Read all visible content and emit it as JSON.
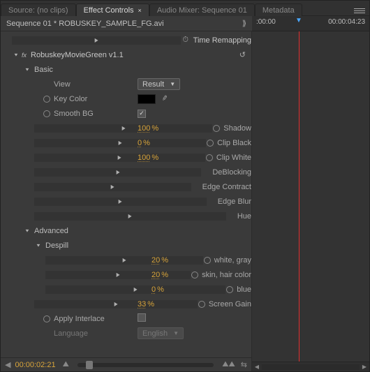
{
  "tabs": {
    "source": "Source: (no clips)",
    "effect_controls": "Effect Controls",
    "audio_mixer": "Audio Mixer: Sequence 01",
    "metadata": "Metadata"
  },
  "header": {
    "breadcrumb": "Sequence 01 * ROBUSKEY_SAMPLE_FG.avi"
  },
  "timeline": {
    "start_tc": ":00:00",
    "end_tc": "00:00:04:23"
  },
  "effects": {
    "time_remapping": "Time Remapping",
    "robuskey": {
      "title": "RobuskeyMovieGreen v1.1",
      "basic": {
        "label": "Basic",
        "view": {
          "label": "View",
          "value": "Result"
        },
        "key_color": {
          "label": "Key Color"
        },
        "smooth_bg": {
          "label": "Smooth BG",
          "checked": true
        },
        "shadow": {
          "label": "Shadow",
          "value": "100",
          "unit": "%"
        },
        "clip_black": {
          "label": "Clip Black",
          "value": "0",
          "unit": "%"
        },
        "clip_white": {
          "label": "Clip White",
          "value": "100",
          "unit": "%"
        },
        "deblocking": {
          "label": "DeBlocking"
        },
        "edge_contract": {
          "label": "Edge Contract"
        },
        "edge_blur": {
          "label": "Edge Blur"
        },
        "hue": {
          "label": "Hue"
        }
      },
      "advanced": {
        "label": "Advanced",
        "despill": {
          "label": "Despill",
          "white_gray": {
            "label": "white, gray",
            "value": "20",
            "unit": "%"
          },
          "skin_hair": {
            "label": "skin, hair color",
            "value": "20",
            "unit": "%"
          },
          "blue": {
            "label": "blue",
            "value": "0",
            "unit": "%"
          }
        },
        "screen_gain": {
          "label": "Screen Gain",
          "value": "33",
          "unit": "%"
        },
        "apply_interlace": {
          "label": "Apply Interlace",
          "checked": false
        },
        "language": {
          "label": "Language",
          "value": "English"
        }
      }
    }
  },
  "footer": {
    "timecode": "00:00:02:21"
  }
}
